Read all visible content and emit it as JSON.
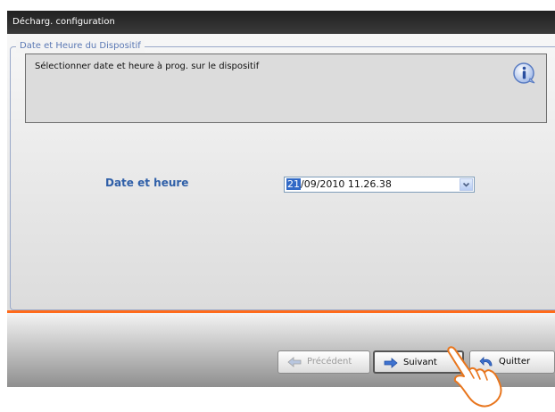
{
  "window": {
    "title": "Décharg. configuration"
  },
  "group": {
    "legend": "Date et Heure du Dispositif"
  },
  "info": {
    "text": "Sélectionner date et heure à prog. sur le dispositif",
    "icon": "info-icon"
  },
  "datetime": {
    "label": "Date et heure",
    "day": "21",
    "rest": "/09/2010 11.26.38"
  },
  "buttons": {
    "previous": "Précédent",
    "next": "Suivant",
    "quit": "Quitter"
  },
  "colors": {
    "titlebar": "#2a2a2a",
    "accent_line": "#ff6a1a",
    "label": "#2f5fa8",
    "selection": "#3169c6"
  }
}
